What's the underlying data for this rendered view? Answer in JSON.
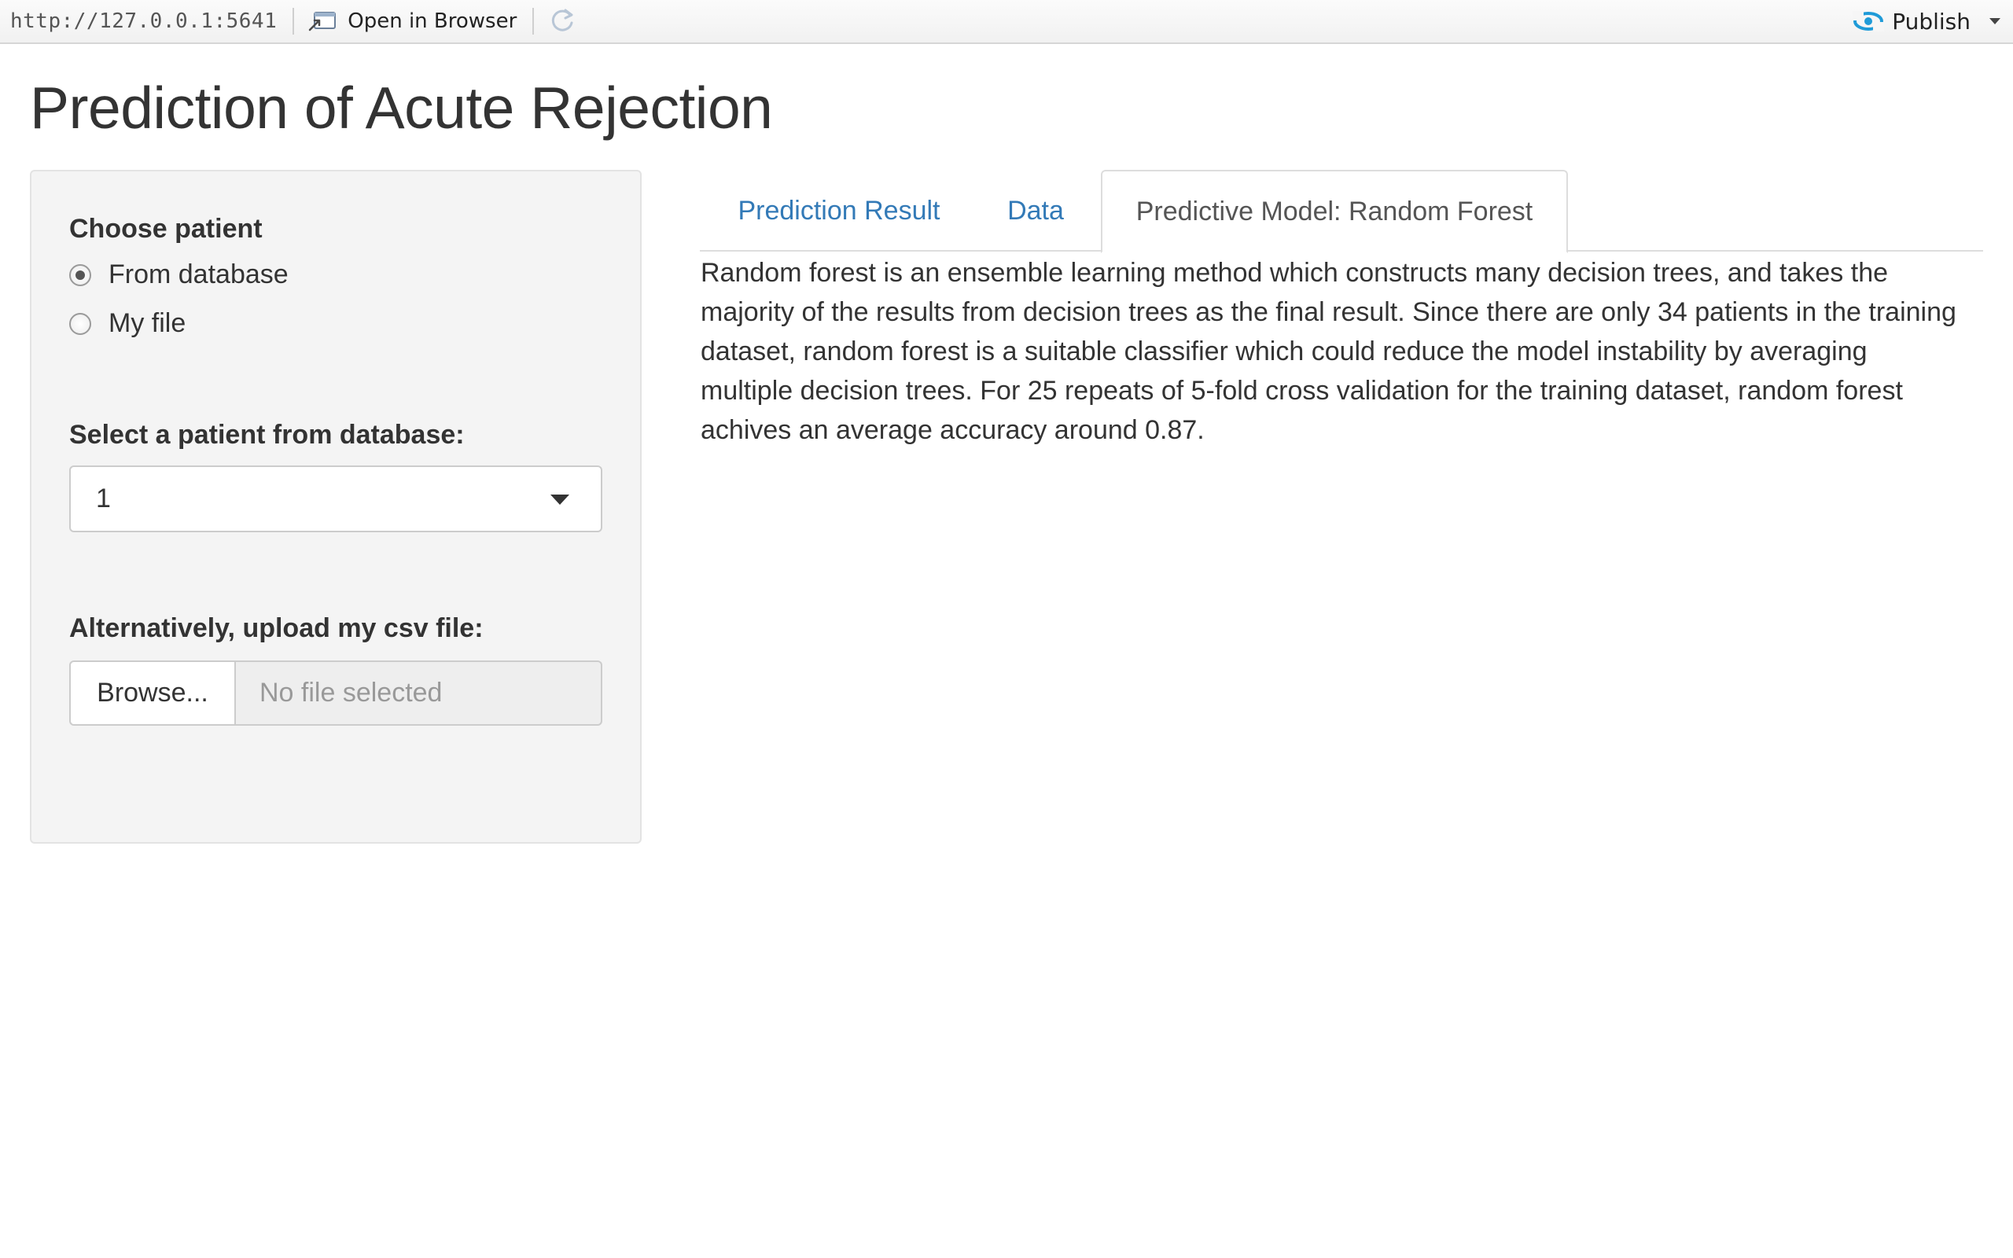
{
  "toolbar": {
    "url": "http://127.0.0.1:5641",
    "open_in_browser": "Open in Browser",
    "publish": "Publish",
    "icons": {
      "open": "open-in-browser-icon",
      "refresh": "refresh-icon",
      "publish": "publish-icon",
      "caret": "chevron-down-icon"
    }
  },
  "page": {
    "title": "Prediction of Acute Rejection"
  },
  "sidebar": {
    "choose_label": "Choose patient",
    "radio_options": [
      {
        "label": "From database",
        "checked": true
      },
      {
        "label": "My file",
        "checked": false
      }
    ],
    "select_label": "Select a patient from database:",
    "select_value": "1",
    "upload_label": "Alternatively, upload my csv file:",
    "browse_button": "Browse...",
    "file_placeholder": "No file selected"
  },
  "tabs": [
    {
      "label": "Prediction Result",
      "active": false
    },
    {
      "label": "Data",
      "active": false
    },
    {
      "label": "Predictive Model: Random Forest",
      "active": true
    }
  ],
  "content": {
    "text": "Random forest is an ensemble learning method which constructs many decision trees, and takes the majority of the results from decision trees as the final result. Since there are only 34 patients in the training dataset, random forest is a suitable classifier which could reduce the model instability by averaging multiple decision trees. For 25 repeats of 5-fold cross validation for the training dataset, random forest achives an average accuracy around 0.87."
  },
  "colors": {
    "link": "#337ab7",
    "text": "#333333",
    "sidebar_bg": "#f4f4f4",
    "publish_icon": "#1f9bd8"
  }
}
